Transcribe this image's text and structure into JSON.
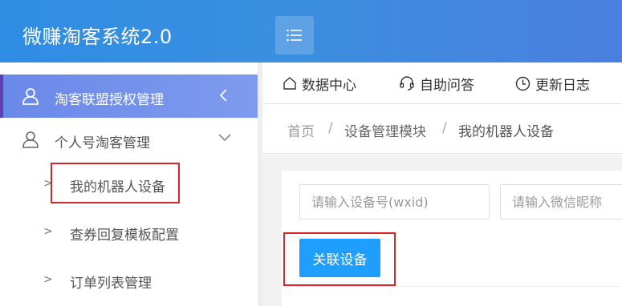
{
  "app": {
    "title": "微赚淘客系统2.0"
  },
  "sidebar": {
    "items": [
      {
        "label": "淘客联盟授权管理",
        "icon": "user-icon",
        "expanded": false
      },
      {
        "label": "个人号淘客管理",
        "icon": "user-icon",
        "expanded": true,
        "children": [
          {
            "label": "我的机器人设备"
          },
          {
            "label": "查券回复模板配置"
          },
          {
            "label": "订单列表管理"
          }
        ]
      }
    ]
  },
  "tabs": [
    {
      "label": "数据中心",
      "icon": "home-icon"
    },
    {
      "label": "自助问答",
      "icon": "headset-icon"
    },
    {
      "label": "更新日志",
      "icon": "clock-icon"
    }
  ],
  "breadcrumb": {
    "items": [
      "首页",
      "设备管理模块",
      "我的机器人设备"
    ],
    "separator": "/"
  },
  "form": {
    "device_placeholder": "请输入设备号(wxid)",
    "nickname_placeholder": "请输入微信昵称",
    "bind_button": "关联设备"
  },
  "colors": {
    "header": "#2f8de4",
    "active_menu": "#7e9bee",
    "primary_button": "#1e9fff",
    "highlight_box": "#d9232d"
  }
}
